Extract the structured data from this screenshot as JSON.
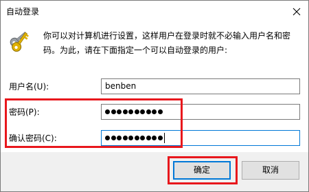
{
  "window": {
    "title": "自动登录",
    "close_icon": "close-icon"
  },
  "intro": {
    "icon": "keys-icon",
    "line1": "你可以对计算机进行设置，这样用户在登录时就不必输入用户名和密",
    "line2": "码。为此，请在下面指定一个可以自动登录的用户:"
  },
  "form": {
    "username": {
      "label": "用户名(U):",
      "value": "benben"
    },
    "password": {
      "label": "密码(P):",
      "masked_length": 10
    },
    "confirm_password": {
      "label": "确认密码(C):",
      "masked_length": 10
    }
  },
  "buttons": {
    "ok_label": "确定",
    "cancel_label": "取消"
  },
  "colors": {
    "annotation": "#e8171c",
    "focus": "#0078d7"
  }
}
